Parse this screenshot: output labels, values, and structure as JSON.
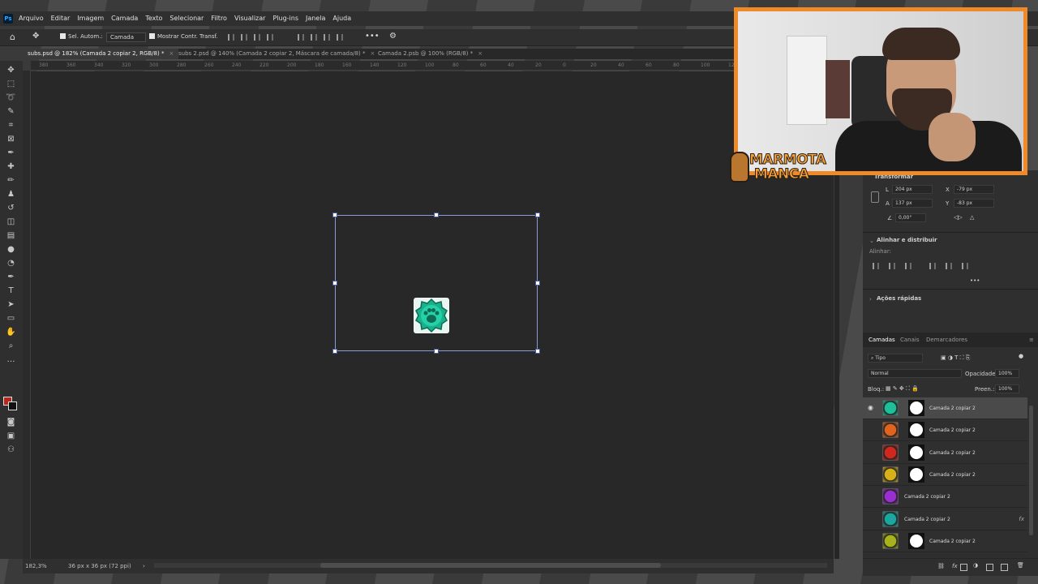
{
  "app": {
    "logo_text": "Ps"
  },
  "menu": [
    "Arquivo",
    "Editar",
    "Imagem",
    "Camada",
    "Texto",
    "Selecionar",
    "Filtro",
    "Visualizar",
    "Plug-ins",
    "Janela",
    "Ajuda"
  ],
  "options": {
    "auto_select_label": "Sel. Autom.:",
    "auto_select_value": "Camada",
    "show_transform_label": "Mostrar Contr. Transf."
  },
  "tabs": [
    {
      "label": "subs.psd @ 182% (Camada 2 copiar 2, RGB/8) *",
      "close": "×"
    },
    {
      "label": "subs 2.psd @ 140% (Camada 2 copiar 2, Máscara de camada/8) *",
      "close": "×"
    },
    {
      "label": "Camada 2.psb @ 100% (RGB/8) *",
      "close": "×"
    }
  ],
  "ruler_top": [
    "380",
    "360",
    "340",
    "320",
    "300",
    "280",
    "260",
    "240",
    "220",
    "200",
    "180",
    "160",
    "140",
    "120",
    "100",
    "80",
    "60",
    "40",
    "20",
    "0",
    "20",
    "40",
    "60",
    "80",
    "100",
    "120",
    "140",
    "160",
    "180",
    "200",
    "220",
    "240",
    "260",
    "280",
    "300",
    "320",
    "340",
    "360",
    "380"
  ],
  "status": {
    "zoom": "182,3%",
    "doc_info": "36 px x 36 px (72 ppi)",
    "arrow": "›"
  },
  "properties": {
    "section_title": "Transformar",
    "w_label": "L",
    "w_value": "204 px",
    "x_label": "X",
    "x_value": "-79 px",
    "h_label": "A",
    "h_value": "137 px",
    "y_label": "Y",
    "y_value": "-83 px",
    "angle_value": "0,00°",
    "align_title": "Alinhar e distribuir",
    "align_label": "Alinhar:",
    "more": "•••",
    "quick_actions_title": "Ações rápidas"
  },
  "layers_panel": {
    "tabs": [
      "Camadas",
      "Canais",
      "Demarcadores"
    ],
    "filter_value": "Tipo",
    "blend_mode": "Normal",
    "opacity_label": "Opacidade:",
    "opacity_value": "100%",
    "lock_label": "Bloq.:",
    "fill_label": "Preen.:",
    "fill_value": "100%",
    "layers": [
      {
        "name": "Camada 2 copiar 2",
        "color": "#1fbf9a",
        "mask": true,
        "selected": true,
        "visible": true,
        "fx": ""
      },
      {
        "name": "Camada 2 copiar 2",
        "color": "#e0641e",
        "mask": true,
        "selected": false,
        "visible": false,
        "fx": ""
      },
      {
        "name": "Camada 2 copiar 2",
        "color": "#d0281e",
        "mask": true,
        "selected": false,
        "visible": false,
        "fx": ""
      },
      {
        "name": "Camada 2 copiar 2",
        "color": "#d8b01a",
        "mask": true,
        "selected": false,
        "visible": false,
        "fx": ""
      },
      {
        "name": "Camada 2 copiar 2",
        "color": "#9b2ed0",
        "mask": false,
        "selected": false,
        "visible": false,
        "fx": ""
      },
      {
        "name": "Camada 2 copiar 2",
        "color": "#1aa7a0",
        "mask": false,
        "selected": false,
        "visible": false,
        "fx": "fx"
      },
      {
        "name": "Camada 2 copiar 2",
        "color": "#a8b21a",
        "mask": true,
        "selected": false,
        "visible": false,
        "fx": ""
      }
    ]
  },
  "overlay": {
    "logo_line1": "MARMOTA",
    "logo_line2": "MANCA"
  }
}
